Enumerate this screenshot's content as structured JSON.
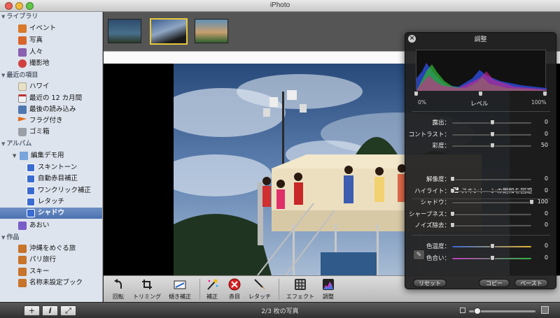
{
  "window": {
    "title": "iPhoto"
  },
  "sidebar": {
    "library_header": "ライブラリ",
    "library_items": [
      {
        "label": "イベント",
        "icon": "events-icon",
        "color": "#d87a2a"
      },
      {
        "label": "写真",
        "icon": "photos-icon",
        "color": "#d8662a"
      },
      {
        "label": "人々",
        "icon": "faces-icon",
        "color": "#8a5fb0"
      },
      {
        "label": "撮影地",
        "icon": "places-icon",
        "color": "#d04040"
      }
    ],
    "recent_header": "最近の項目",
    "recent_items": [
      {
        "label": "ハワイ",
        "icon": "event-icon",
        "color": "#e8e0c8"
      },
      {
        "label": "最近の 12 カ月間",
        "icon": "calendar-icon",
        "color": "#f2f2f2"
      },
      {
        "label": "最後の読み込み",
        "icon": "import-icon",
        "color": "#5078b0"
      },
      {
        "label": "フラグ付き",
        "icon": "flag-icon",
        "color": "#e06a1c"
      },
      {
        "label": "ゴミ箱",
        "icon": "trash-icon",
        "color": "#9aa0a6"
      }
    ],
    "albums_header": "アルバム",
    "albums_folder": {
      "label": "編集デモ用",
      "icon": "folder-icon",
      "color": "#7aa4dc"
    },
    "album_children": [
      {
        "label": "スキントーン",
        "icon": "album-icon",
        "color": "#3a6bd0"
      },
      {
        "label": "自動赤目補正",
        "icon": "album-icon",
        "color": "#3a6bd0"
      },
      {
        "label": "ワンクリック補正",
        "icon": "album-icon",
        "color": "#3a6bd0"
      },
      {
        "label": "レタッチ",
        "icon": "album-icon",
        "color": "#3a6bd0"
      },
      {
        "label": "シャドウ",
        "icon": "album-icon",
        "color": "#3a6bd0"
      }
    ],
    "album_other": {
      "label": "あおい",
      "icon": "smart-album-icon",
      "color": "#7a5cc8"
    },
    "projects_header": "作品",
    "projects": [
      {
        "label": "沖縄をめぐる旅",
        "icon": "book-icon",
        "color": "#c8742a"
      },
      {
        "label": "パリ旅行",
        "icon": "book-icon",
        "color": "#c8742a"
      },
      {
        "label": "スキー",
        "icon": "book-icon",
        "color": "#c8742a"
      },
      {
        "label": "名称未設定ブック",
        "icon": "book-icon",
        "color": "#c8742a"
      }
    ]
  },
  "toolbar": {
    "tools": [
      {
        "label": "回転",
        "icon": "rotate-icon"
      },
      {
        "label": "トリミング",
        "icon": "crop-icon"
      },
      {
        "label": "傾き補正",
        "icon": "straighten-icon"
      },
      {
        "label": "補正",
        "icon": "enhance-icon"
      },
      {
        "label": "赤目",
        "icon": "red-eye-icon"
      },
      {
        "label": "レタッチ",
        "icon": "retouch-icon"
      },
      {
        "label": "エフェクト",
        "icon": "effects-icon"
      },
      {
        "label": "調整",
        "icon": "adjust-icon"
      }
    ]
  },
  "bottom": {
    "photo_count": "2/3 枚の写真",
    "buttons": [
      "+",
      "i",
      "⤢"
    ],
    "zoom_level": 0.08
  },
  "adjust": {
    "title": "調整",
    "levels_min": "0%",
    "levels_label": "レベル",
    "levels_max": "100%",
    "sliders_a": [
      {
        "label": "露出：",
        "value": "0",
        "level": 0.5
      },
      {
        "label": "コントラスト：",
        "value": "0",
        "level": 0.5
      },
      {
        "label": "彩度：",
        "value": "50",
        "level": 0.5
      }
    ],
    "skin_checkbox": "スキントーンの飽和を回避",
    "skin_checked": "✓",
    "sliders_b": [
      {
        "label": "解像度：",
        "value": "0",
        "level": 0.0
      },
      {
        "label": "ハイライト：",
        "value": "0",
        "level": 0.0
      },
      {
        "label": "シャドウ：",
        "value": "100",
        "level": 1.0
      },
      {
        "label": "シャープネス：",
        "value": "0",
        "level": 0.0
      },
      {
        "label": "ノイズ除去：",
        "value": "0",
        "level": 0.0
      }
    ],
    "sliders_c": [
      {
        "label": "色温度：",
        "value": "0",
        "level": 0.5
      },
      {
        "label": "色合い：",
        "value": "0",
        "level": 0.5
      }
    ],
    "reset": "リセット",
    "copy": "コピー",
    "paste": "ペースト"
  }
}
